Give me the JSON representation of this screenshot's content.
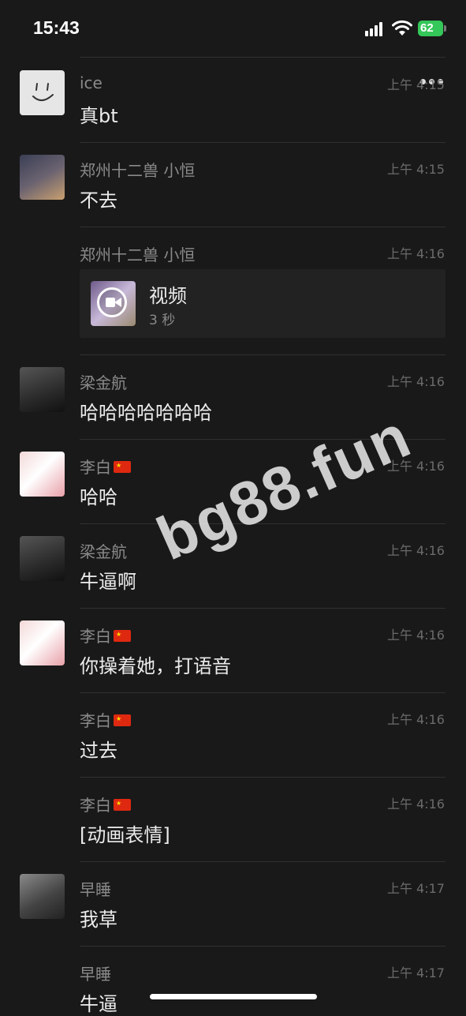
{
  "status_bar": {
    "time": "15:43",
    "battery": "62"
  },
  "messages": [
    {
      "name": "ice",
      "time": "上午 4:15",
      "text": "真bt",
      "avatar": "smiley-face"
    },
    {
      "name": "郑州十二兽  小恒",
      "time": "上午 4:15",
      "text": "不去",
      "avatar": "person-photo"
    },
    {
      "name": "郑州十二兽  小恒",
      "time": "上午 4:16",
      "video": {
        "title": "视频",
        "duration": "3 秒"
      }
    },
    {
      "name": "梁金航",
      "time": "上午 4:16",
      "text": "哈哈哈哈哈哈哈",
      "avatar": "person-bw-photo"
    },
    {
      "name": "李白",
      "time": "上午 4:16",
      "text": "哈哈",
      "avatar": "white-dog-photo",
      "flag": true
    },
    {
      "name": "梁金航",
      "time": "上午 4:16",
      "text": "牛逼啊",
      "avatar": "person-bw-photo"
    },
    {
      "name": "李白",
      "time": "上午 4:16",
      "text": "你操着她，打语音",
      "avatar": "white-dog-photo",
      "flag": true
    },
    {
      "name": "李白",
      "time": "上午 4:16",
      "text": "过去",
      "flag": true
    },
    {
      "name": "李白",
      "time": "上午 4:16",
      "text": "[动画表情]",
      "flag": true
    },
    {
      "name": "早睡",
      "time": "上午 4:17",
      "text": "我草",
      "avatar": "person-sitting-photo"
    },
    {
      "name": "早睡",
      "time": "上午 4:17",
      "text": "牛逼"
    }
  ],
  "watermark": "bg88.fun",
  "colors": {
    "background": "#191919",
    "battery": "#34c759",
    "name_text": "#8a8a8a",
    "message_text": "#ececec"
  }
}
